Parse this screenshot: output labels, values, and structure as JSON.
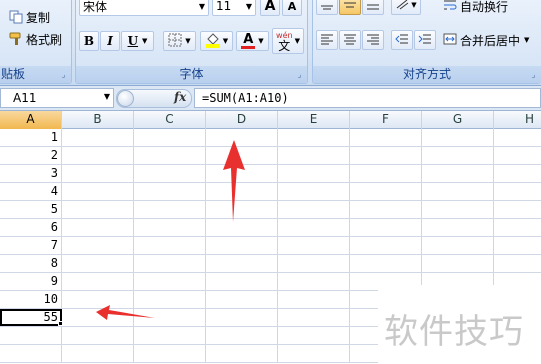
{
  "clipboard": {
    "copy_label": "复制",
    "format_painter_label": "格式刷",
    "group_label": "贴板"
  },
  "font": {
    "name": "宋体",
    "size": "11",
    "grow_label": "A",
    "shrink_label": "A",
    "bold": "B",
    "italic": "I",
    "underline": "U",
    "font_color_glyph": "A",
    "phonetic_top": "wén",
    "phonetic_glyph": "文",
    "group_label": "字体"
  },
  "alignment": {
    "wrap_text_label": "自动换行",
    "merge_center_label": "合并后居中",
    "group_label": "对齐方式"
  },
  "formula_bar": {
    "name_box": "A11",
    "fx": "fx",
    "formula": "=SUM(A1:A10)"
  },
  "grid": {
    "columns": [
      "A",
      "B",
      "C",
      "D",
      "E",
      "F",
      "G",
      "H"
    ],
    "selected_column": "A",
    "column_a_values": [
      "1",
      "2",
      "3",
      "4",
      "5",
      "6",
      "7",
      "8",
      "9",
      "10",
      "55"
    ],
    "active_cell_value": "55"
  },
  "colors": {
    "arrow_red": "#e8312f",
    "selected_header": "#f1b74f",
    "ribbon_text": "#15428b"
  },
  "watermark": "软件技巧"
}
